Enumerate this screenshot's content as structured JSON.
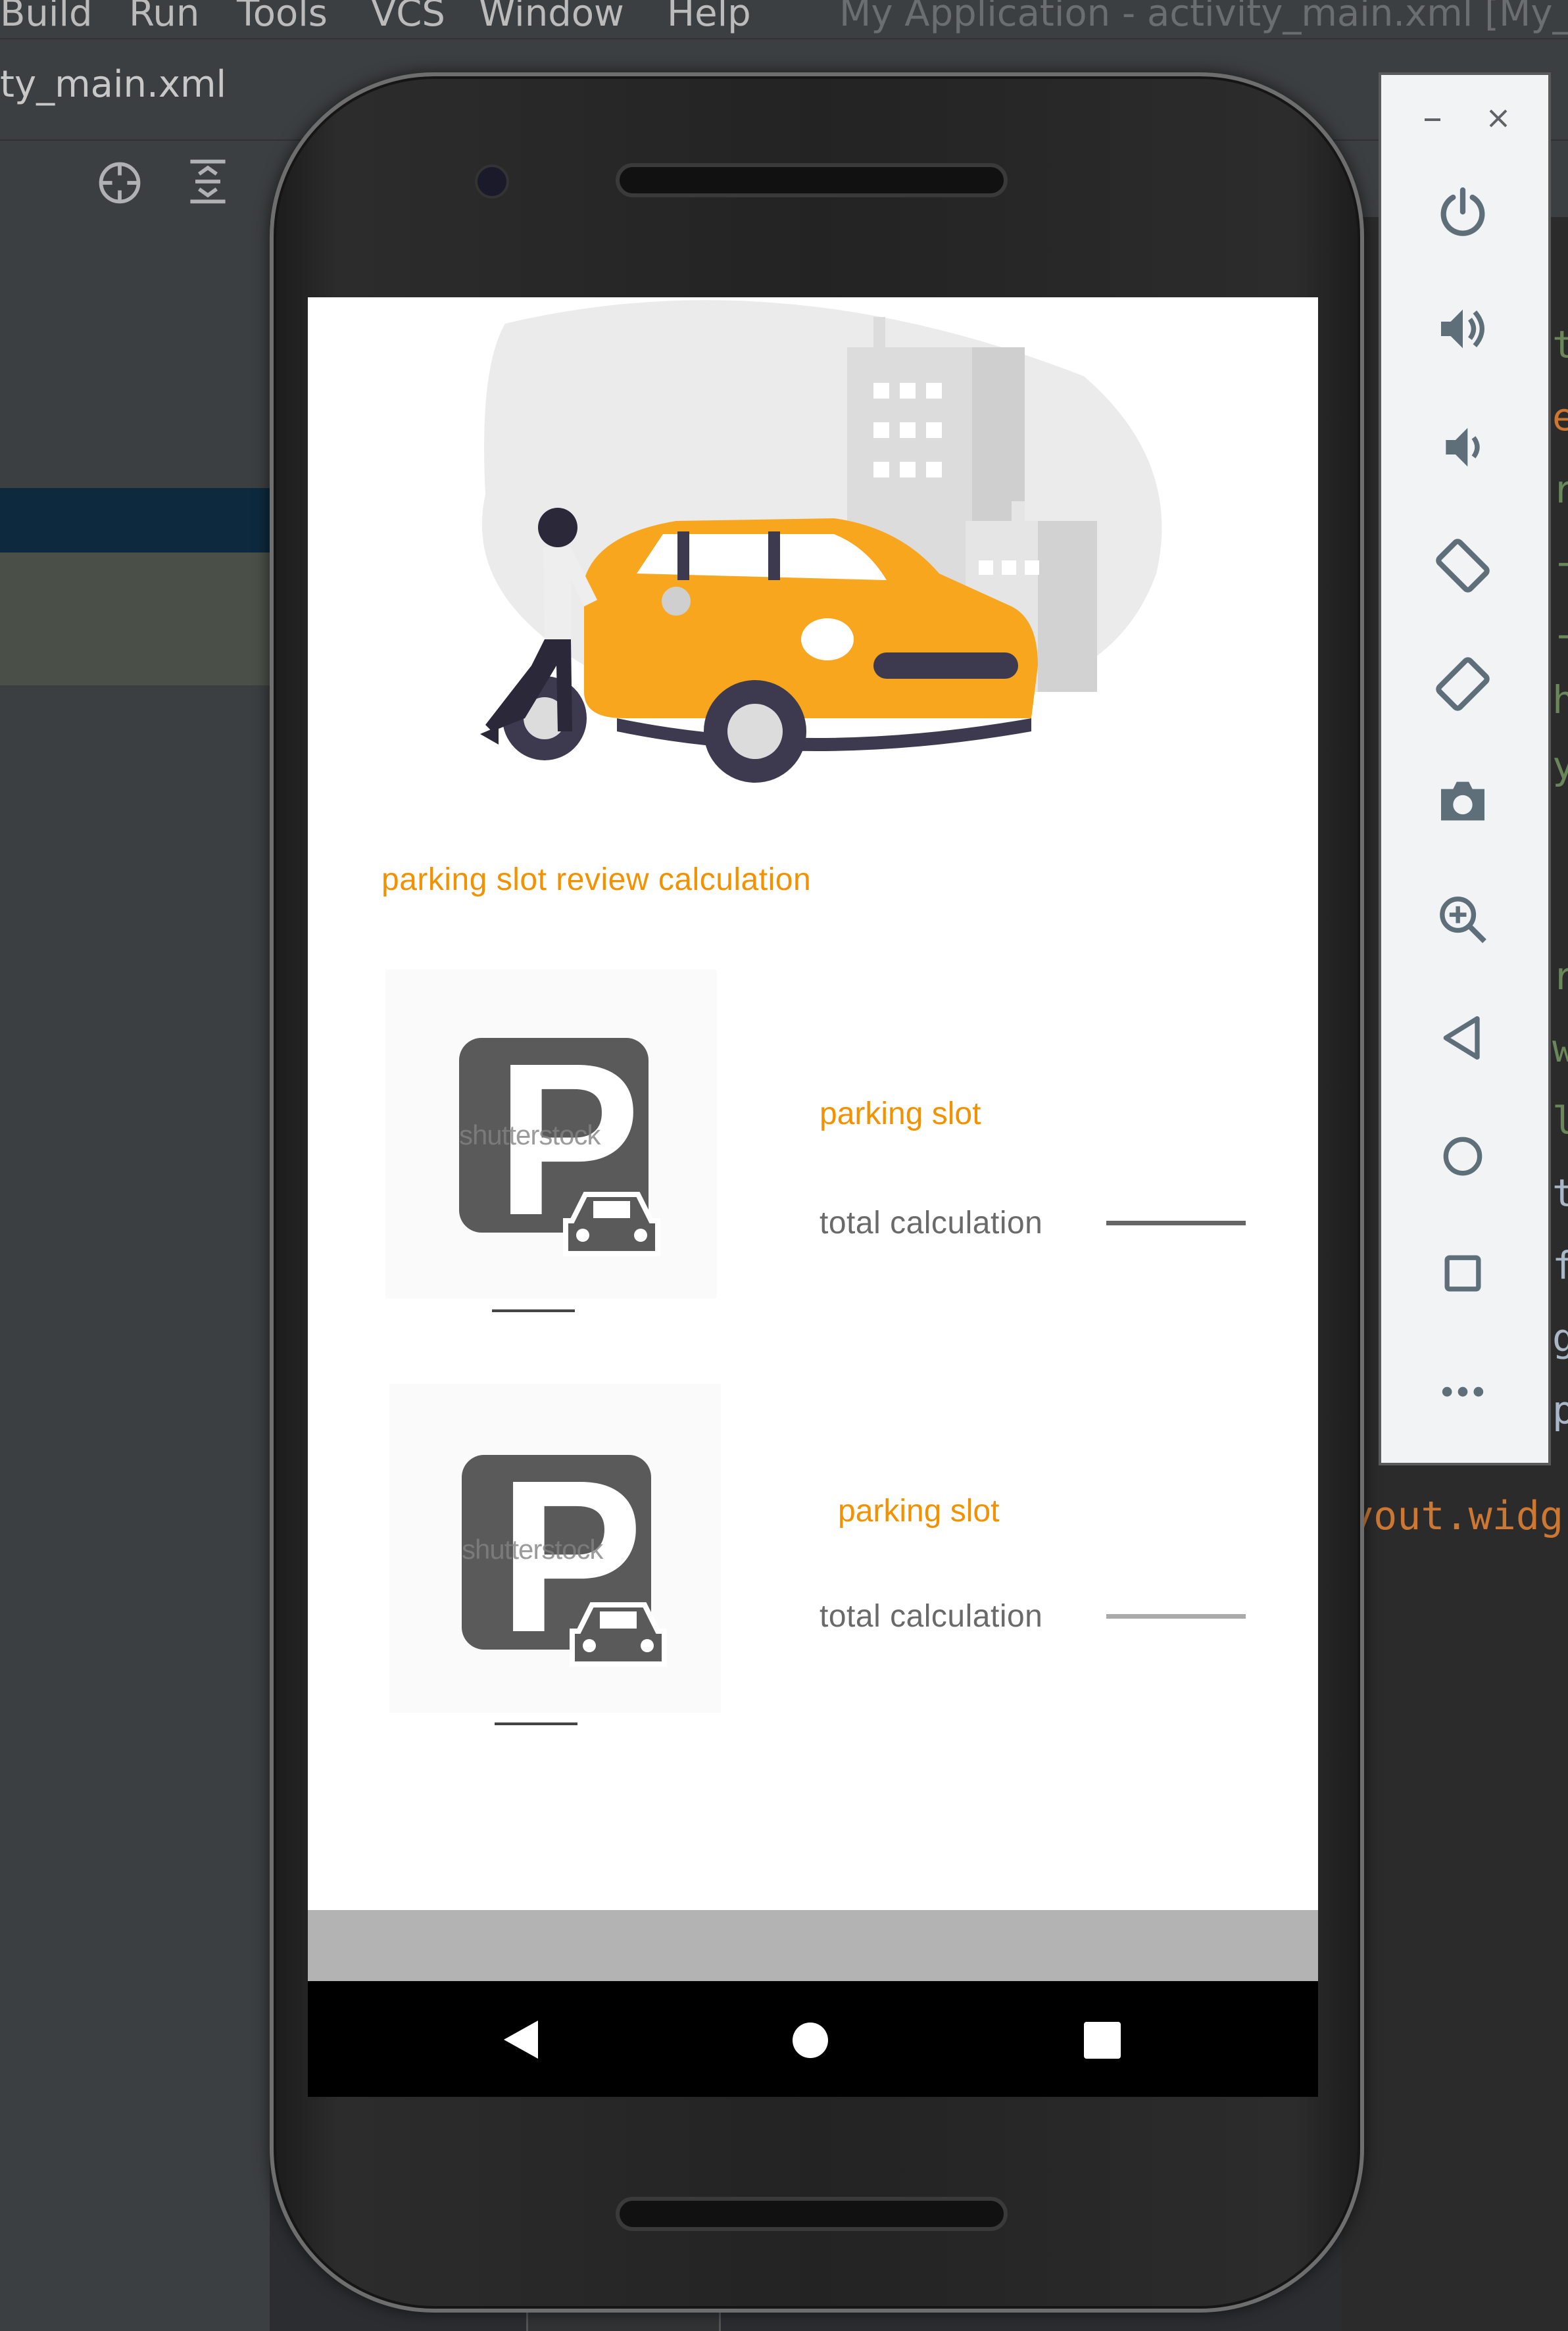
{
  "ide": {
    "menu": [
      "Build",
      "Run",
      "Tools",
      "VCS",
      "Window",
      "Help"
    ],
    "window_title": "My Application - activity_main.xml [My_Ap",
    "file_tab": "ty_main.xml",
    "code_snippet": "yout.widg",
    "code_chars": [
      "t",
      "e",
      "r",
      "-",
      "-",
      "h",
      "y",
      "r",
      "w",
      "l",
      "t",
      "f",
      "g",
      "p"
    ]
  },
  "app": {
    "title": "parking slot review calculation",
    "cards": [
      {
        "image_watermark": "shutterstock",
        "slot_label": "parking slot",
        "calc_label": "total calculation",
        "line_color": "#666666"
      },
      {
        "image_watermark": "shutterstock",
        "slot_label": "parking slot",
        "calc_label": "total calculation",
        "line_color": "#aaaaaa"
      }
    ],
    "accent_color": "#f39200"
  },
  "emulator_toolbar": {
    "window_controls": [
      "minimize-icon",
      "close-icon"
    ],
    "buttons": [
      "power-icon",
      "volume-up-icon",
      "volume-down-icon",
      "rotate-left-icon",
      "rotate-right-icon",
      "camera-icon",
      "zoom-icon",
      "back-icon",
      "home-icon",
      "overview-icon",
      "more-icon"
    ]
  },
  "navbar": [
    "back-icon",
    "home-icon",
    "recents-icon"
  ]
}
